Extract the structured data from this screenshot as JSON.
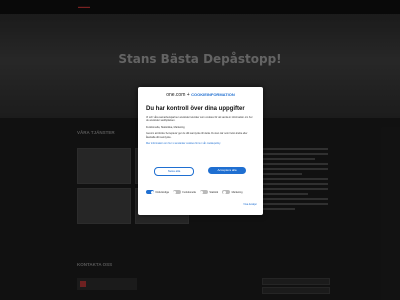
{
  "site": {
    "nav": [
      "",
      "",
      "",
      ""
    ],
    "hero": {
      "title": "Stans Bästa Depåstopp!",
      "subtitle": ""
    },
    "services": {
      "title": "VÅRA TJÄNSTER",
      "cards": [
        {
          "label": ""
        },
        {
          "label": ""
        },
        {
          "label": ""
        },
        {
          "label": ""
        }
      ]
    },
    "contact": {
      "title": "KONTAKTA OSS",
      "company": ""
    }
  },
  "modal": {
    "brand_left": "one.com",
    "brand_right": "COOKIEINFORMATION",
    "title": "Du har kontroll över dina uppgifter",
    "paragraphs": [
      "Vi och våra samarbetspartner använder tekniker som cookies för att samla in information om hur du använder webbplatsen.",
      "Funktionella, Statistiska, Marketing",
      "Genom att klicka 'Acceptera' ger du ditt samtycke till detta. Du kan när som helst ändra eller återkalla ditt samtycke.",
      "Mer information om hur vi använder cookies finns i vår cookiepolicy."
    ],
    "deny_label": "Neka alla",
    "accept_label": "Acceptera alla",
    "toggles": [
      {
        "label": "Nödvändiga",
        "on": true
      },
      {
        "label": "Funktionella",
        "on": false
      },
      {
        "label": "Statistik",
        "on": false
      },
      {
        "label": "Marketing",
        "on": false
      }
    ],
    "details_link": "Visa detaljer"
  },
  "colors": {
    "accent": "#1f6fd1",
    "logo_red": "#b33333"
  }
}
